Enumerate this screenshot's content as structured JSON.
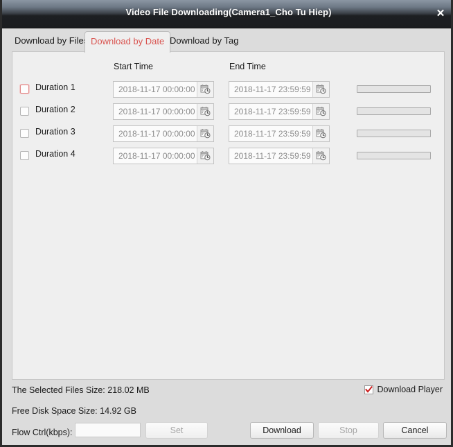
{
  "window": {
    "title": "Video File Downloading(Camera1_Cho Tu Hiep)",
    "close_label": "✕"
  },
  "tabs": [
    {
      "label": "Download by Files",
      "active": false
    },
    {
      "label": "Download by Date",
      "active": true
    },
    {
      "label": "Download by Tag",
      "active": false
    }
  ],
  "panel": {
    "headers": {
      "start_time": "Start Time",
      "end_time": "End Time"
    },
    "rows": [
      {
        "label": "Duration 1",
        "checked": false,
        "focused": true,
        "start_value": "2018-11-17 00:00:00",
        "end_value": "2018-11-17 23:59:59",
        "progress": 0
      },
      {
        "label": "Duration 2",
        "checked": false,
        "focused": false,
        "start_value": "2018-11-17 00:00:00",
        "end_value": "2018-11-17 23:59:59",
        "progress": 0
      },
      {
        "label": "Duration 3",
        "checked": false,
        "focused": false,
        "start_value": "2018-11-17 00:00:00",
        "end_value": "2018-11-17 23:59:59",
        "progress": 0
      },
      {
        "label": "Duration 4",
        "checked": false,
        "focused": false,
        "start_value": "2018-11-17 00:00:00",
        "end_value": "2018-11-17 23:59:59",
        "progress": 0
      }
    ]
  },
  "footer": {
    "selected_files_size": "The Selected Files Size:  218.02 MB",
    "free_disk_space": "Free Disk Space Size:  14.92 GB",
    "flow_ctrl_label": "Flow Ctrl(kbps):",
    "flow_ctrl_value": "",
    "flow_ctrl_placeholder": "",
    "download_player_label": "Download Player",
    "download_player_checked": true,
    "buttons": {
      "set": "Set",
      "download": "Download",
      "stop": "Stop",
      "cancel": "Cancel"
    }
  },
  "colors": {
    "accent_red": "#d9534f",
    "titlebar_dark": "#1b1d20",
    "panel_bg": "#efefef",
    "dialog_bg": "#dcdcdc"
  }
}
